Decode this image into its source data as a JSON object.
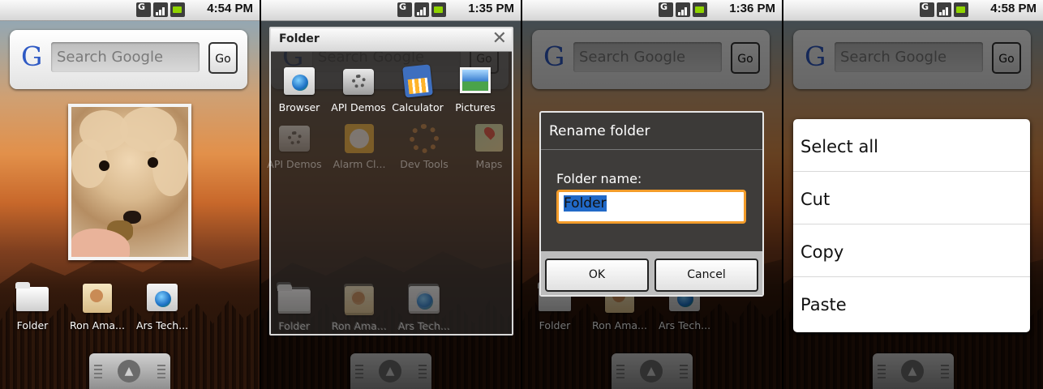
{
  "screens": [
    {
      "clock": "4:54 PM"
    },
    {
      "clock": "1:35 PM"
    },
    {
      "clock": "1:36 PM"
    },
    {
      "clock": "4:58 PM"
    }
  ],
  "status_icons": {
    "data": "G"
  },
  "search_widget": {
    "logo": "G",
    "placeholder": "Search Google",
    "go_label": "Go"
  },
  "desktop_icons": [
    {
      "label": "Folder",
      "icon": "folder-icon"
    },
    {
      "label": "Ron Ama...",
      "icon": "contact-icon"
    },
    {
      "label": "Ars Tech...",
      "icon": "browser-bookmark-icon"
    }
  ],
  "folder_popup": {
    "title": "Folder",
    "close": "✕",
    "items": [
      {
        "label": "Browser",
        "icon": "browser-icon"
      },
      {
        "label": "API Demos",
        "icon": "api-demos-icon"
      },
      {
        "label": "Calculator",
        "icon": "calculator-icon"
      },
      {
        "label": "Pictures",
        "icon": "pictures-icon"
      }
    ],
    "background_items": [
      {
        "label": "API Demos",
        "icon": "api-demos-icon"
      },
      {
        "label": "Alarm Cl...",
        "icon": "alarm-clock-icon"
      },
      {
        "label": "Dev Tools",
        "icon": "dev-tools-icon"
      },
      {
        "label": "Maps",
        "icon": "maps-icon"
      }
    ]
  },
  "rename_dialog": {
    "title": "Rename folder",
    "field_label": "Folder name:",
    "field_value": "Folder",
    "ok_label": "OK",
    "cancel_label": "Cancel"
  },
  "context_menu": {
    "items": [
      "Select all",
      "Cut",
      "Copy",
      "Paste"
    ]
  },
  "colors": {
    "accent_focus": "#f39c2a",
    "selection": "#2169c7",
    "battery": "#8fd400"
  }
}
